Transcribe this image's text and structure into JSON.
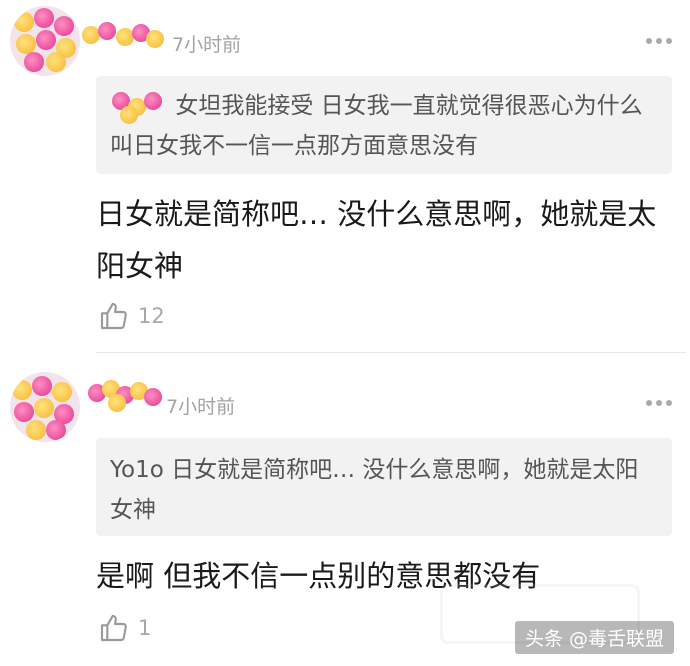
{
  "comments": [
    {
      "time": "7小时前",
      "quote_text": "女坦我能接受 日女我一直就觉得很恶心为什么叫日女我不一信一点那方面意思没有",
      "body": "日女就是简称吧… 没什么意思啊，她就是太阳女神",
      "likes": "12"
    },
    {
      "time": "7小时前",
      "quote_text": "Yo1o 日女就是简称吧… 没什么意思啊，她就是太阳女神",
      "body": "是啊 但我不信一点别的意思都没有",
      "likes": "1"
    }
  ],
  "watermark": "头条 @毒舌联盟",
  "icons": [
    "more-icon",
    "thumbs-up-icon",
    "avatar",
    "emoji-sticker"
  ]
}
